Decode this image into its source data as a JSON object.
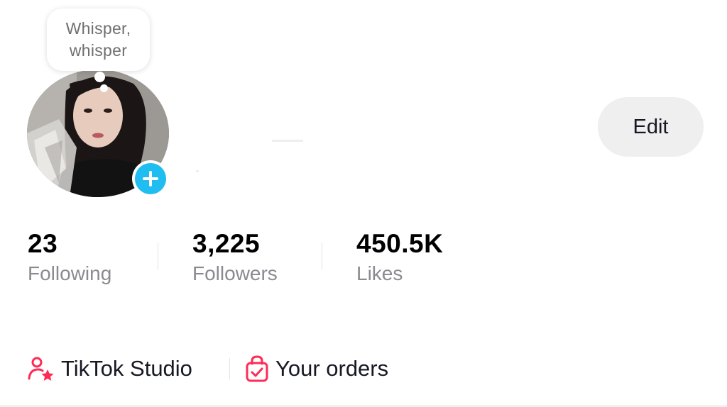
{
  "note": {
    "line1": "Whisper,",
    "line2": "whisper"
  },
  "profile": {
    "edit_label": "Edit"
  },
  "stats": [
    {
      "value": "23",
      "label": "Following"
    },
    {
      "value": "3,225",
      "label": "Followers"
    },
    {
      "value": "450.5K",
      "label": "Likes"
    }
  ],
  "links": {
    "studio_label": "TikTok Studio",
    "orders_label": "Your orders"
  },
  "colors": {
    "accent_pink": "#fe2c55",
    "add_blue": "#20bdf0",
    "edit_bg": "#efefef",
    "muted_text": "#8a8b91"
  },
  "icons": {
    "add": "plus-icon",
    "studio": "creator-star-icon",
    "orders": "shopping-bag-check-icon"
  }
}
